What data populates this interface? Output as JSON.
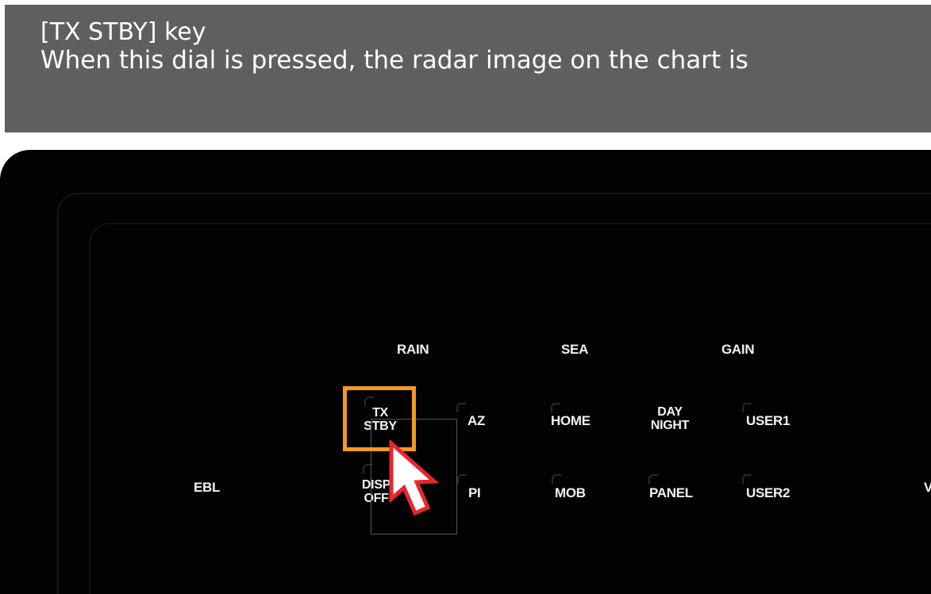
{
  "banner": {
    "title": "[TX STBY] key",
    "description": "When this dial is pressed, the radar image on the chart is"
  },
  "panel": {
    "top_labels": {
      "rain": "RAIN",
      "sea": "SEA",
      "gain": "GAIN"
    },
    "keys": {
      "tx_stby": [
        "TX",
        "STBY"
      ],
      "az": "AZ",
      "home": "HOME",
      "day_night": [
        "DAY",
        "NIGHT"
      ],
      "user1": "USER1",
      "ebl": "EBL",
      "disp_off": [
        "DISP",
        "OFF"
      ],
      "pi": "PI",
      "mob": "MOB",
      "panel": "PANEL",
      "user2": "USER2",
      "edge": "V"
    }
  },
  "colors": {
    "banner_bg": "#5f5f5f",
    "panel_bg": "#020202",
    "highlight": "#f39a1e",
    "cursor_outline": "#e8262b"
  },
  "icons": {
    "pointer": "pointer-cursor-icon"
  }
}
